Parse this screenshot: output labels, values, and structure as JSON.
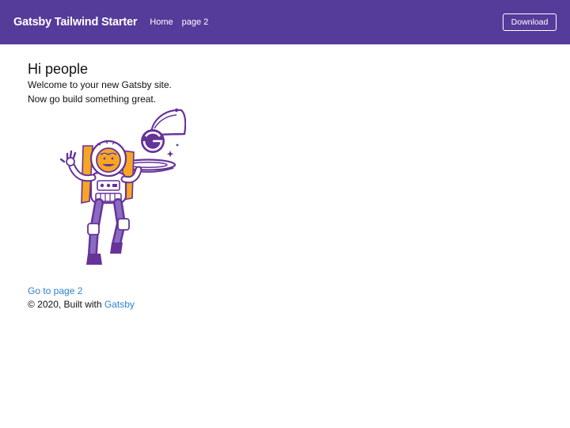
{
  "header": {
    "brand": "Gatsby Tailwind Starter",
    "nav": [
      {
        "label": "Home"
      },
      {
        "label": "page 2"
      }
    ],
    "download_label": "Download"
  },
  "main": {
    "heading": "Hi people",
    "line1": "Welcome to your new Gatsby site.",
    "line2": "Now go build something great.",
    "image": "astronaut-illustration",
    "page2_link": "Go to page 2"
  },
  "footer": {
    "prefix": "© 2020, Built with",
    "link": "Gatsby"
  },
  "colors": {
    "header_bg": "#553c9a",
    "link": "#3182ce",
    "illustration_purple": "#663399",
    "illustration_orange": "#f6a623"
  }
}
